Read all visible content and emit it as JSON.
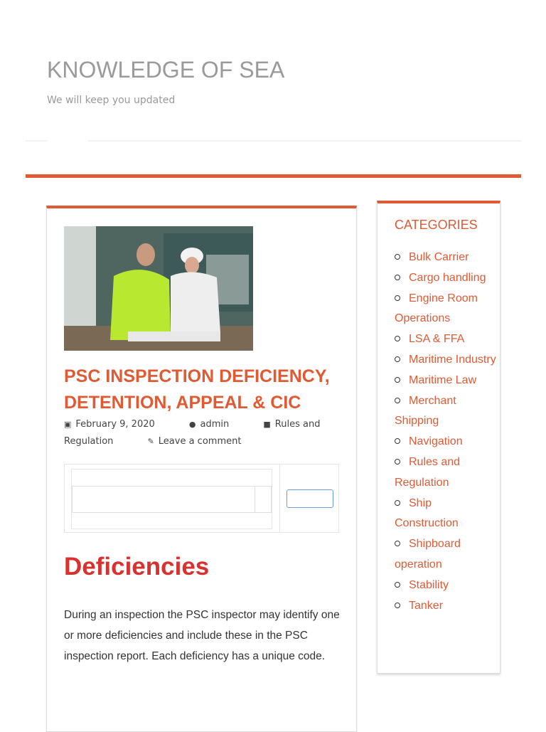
{
  "site": {
    "title": "KNOWLEDGE OF SEA",
    "tagline": "We will keep you updated"
  },
  "colors": {
    "accent": "#e05a33",
    "heading": "#d9312e"
  },
  "post": {
    "title": "PSC INSPECTION DEFICIENCY, DETENTION, APPEAL & CIC",
    "date": "February 9, 2020",
    "author": "admin",
    "category": "Rules and Regulation",
    "comment_link": "Leave a comment",
    "heading": "Deficiencies",
    "paragraph": "During an inspection the PSC inspector may identify one or more deficiencies and include these in the PSC inspection report. Each deficiency has a unique code."
  },
  "sidebar": {
    "title": "CATEGORIES",
    "items": [
      "Bulk Carrier",
      "Cargo handling",
      "Engine Room Operations",
      "LSA & FFA",
      "Maritime Industry",
      "Maritime Law",
      "Merchant Shipping",
      "Navigation",
      "Rules and Regulation",
      "Ship Construction",
      "Shipboard operation",
      "Stability",
      "Tanker"
    ]
  }
}
